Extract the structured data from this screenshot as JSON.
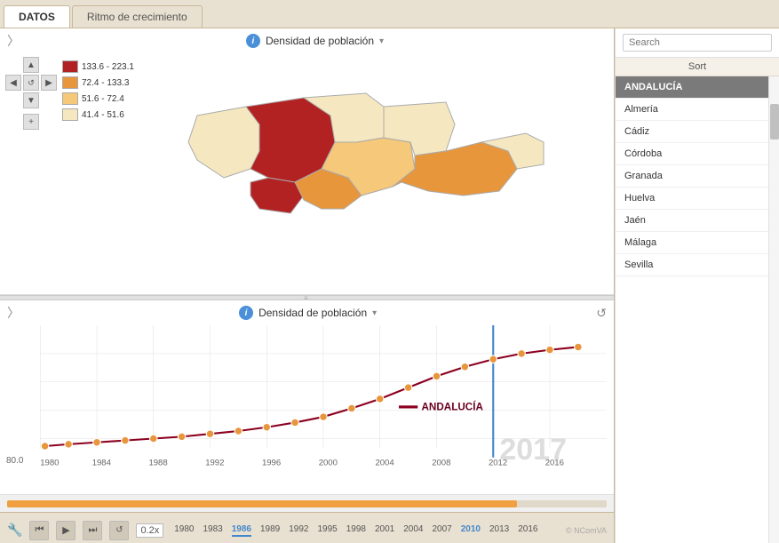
{
  "tabs": [
    {
      "id": "datos",
      "label": "DATOS",
      "active": true
    },
    {
      "id": "ritmo",
      "label": "Ritmo de crecimiento",
      "active": false
    }
  ],
  "map": {
    "title": "Densidad de población",
    "info_icon": "i",
    "legend": [
      {
        "color": "#b22222",
        "range": "133.6 - 223.1"
      },
      {
        "color": "#e8963c",
        "range": "72.4 - 133.3"
      },
      {
        "color": "#f5c87a",
        "range": "51.6 - 72.4"
      },
      {
        "color": "#f5e8c0",
        "range": "41.4 - 51.6"
      }
    ]
  },
  "chart": {
    "title": "Densidad de población",
    "info_icon": "i",
    "y_label": "80.0",
    "year_watermark": "2017",
    "legend_label": "ANDALUCÍA",
    "x_axis": [
      "1980",
      "1984",
      "1988",
      "1992",
      "1996",
      "2000",
      "2004",
      "2008",
      "2012",
      "2016"
    ]
  },
  "sidebar": {
    "search_placeholder": "Search",
    "sort_label": "Sort",
    "regions": [
      {
        "id": "andalucia",
        "name": "ANDALUCÍA",
        "selected": true
      },
      {
        "id": "almeria",
        "name": "Almería",
        "selected": false
      },
      {
        "id": "cadiz",
        "name": "Cádiz",
        "selected": false
      },
      {
        "id": "cordoba",
        "name": "Córdoba",
        "selected": false
      },
      {
        "id": "granada",
        "name": "Granada",
        "selected": false
      },
      {
        "id": "huelva",
        "name": "Huelva",
        "selected": false
      },
      {
        "id": "jaen",
        "name": "Jaén",
        "selected": false
      },
      {
        "id": "malaga",
        "name": "Málaga",
        "selected": false
      },
      {
        "id": "sevilla",
        "name": "Sevilla",
        "selected": false
      }
    ]
  },
  "timeline": {
    "years": [
      "1980",
      "1983",
      "1986",
      "1989",
      "1992",
      "1995",
      "1998",
      "2001",
      "2004",
      "2007",
      "2010",
      "2013",
      "2016"
    ],
    "zoom": "0.2x",
    "current_year": "2010",
    "fill_percent": 85
  },
  "copyright": "© NComVA"
}
